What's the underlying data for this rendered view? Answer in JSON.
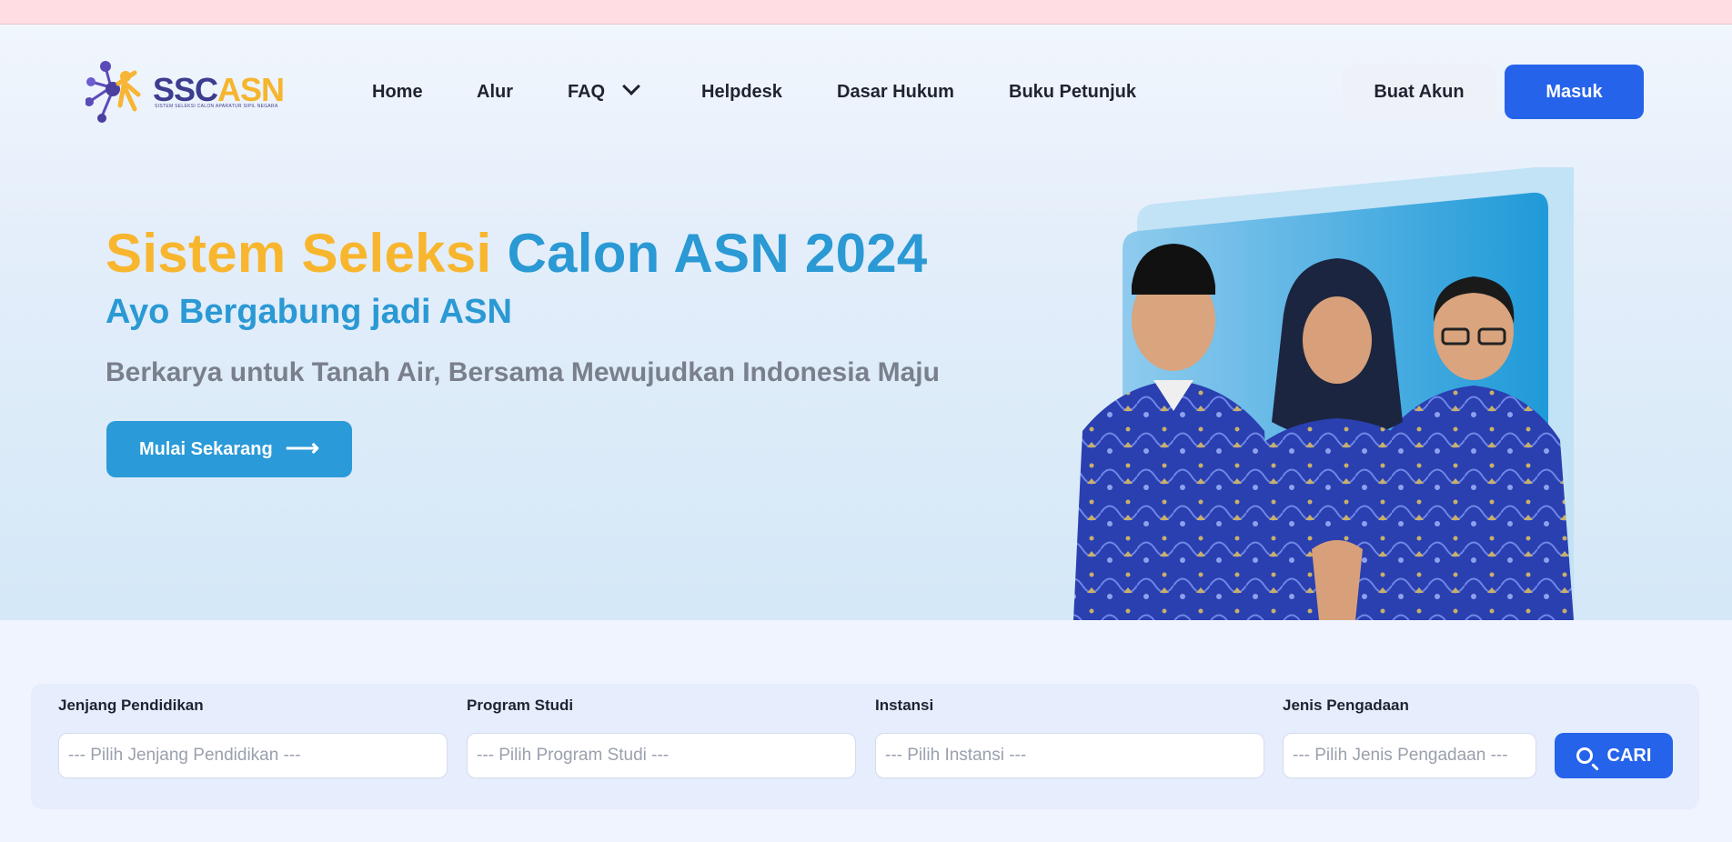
{
  "logo": {
    "brand_part1": "SSC",
    "brand_part2": "ASN",
    "subtitle": "SISTEM SELEKSI CALON APARATUR SIPIL NEGARA"
  },
  "nav": {
    "items": [
      {
        "label": "Home"
      },
      {
        "label": "Alur"
      },
      {
        "label": "FAQ"
      },
      {
        "label": "Helpdesk"
      },
      {
        "label": "Dasar Hukum"
      },
      {
        "label": "Buku Petunjuk"
      }
    ],
    "create_account_label": "Buat Akun",
    "login_label": "Masuk"
  },
  "hero": {
    "title_part1": "Sistem Seleksi",
    "title_part2": "Calon ASN 2024",
    "subtitle": "Ayo Bergabung jadi ASN",
    "tagline": "Berkarya untuk Tanah Air, Bersama Mewujudkan Indonesia Maju",
    "cta_label": "Mulai Sekarang",
    "cta_arrow": "⟶"
  },
  "search": {
    "fields": [
      {
        "label": "Jenjang Pendidikan",
        "placeholder": "--- Pilih Jenjang Pendidikan ---"
      },
      {
        "label": "Program Studi",
        "placeholder": "--- Pilih Program Studi ---"
      },
      {
        "label": "Instansi",
        "placeholder": "--- Pilih Instansi ---"
      },
      {
        "label": "Jenis Pengadaan",
        "placeholder": "--- Pilih Jenis Pengadaan ---"
      }
    ],
    "button_label": "CARI"
  },
  "colors": {
    "primary": "#2563eb",
    "accent_blue": "#2a99d4",
    "accent_yellow": "#f8b62e",
    "top_strip": "#ffdde3",
    "batik": "#2a3fb0"
  },
  "icons": [
    "logo-mark",
    "chevron-down-icon",
    "arrow-right-icon",
    "search-icon"
  ]
}
